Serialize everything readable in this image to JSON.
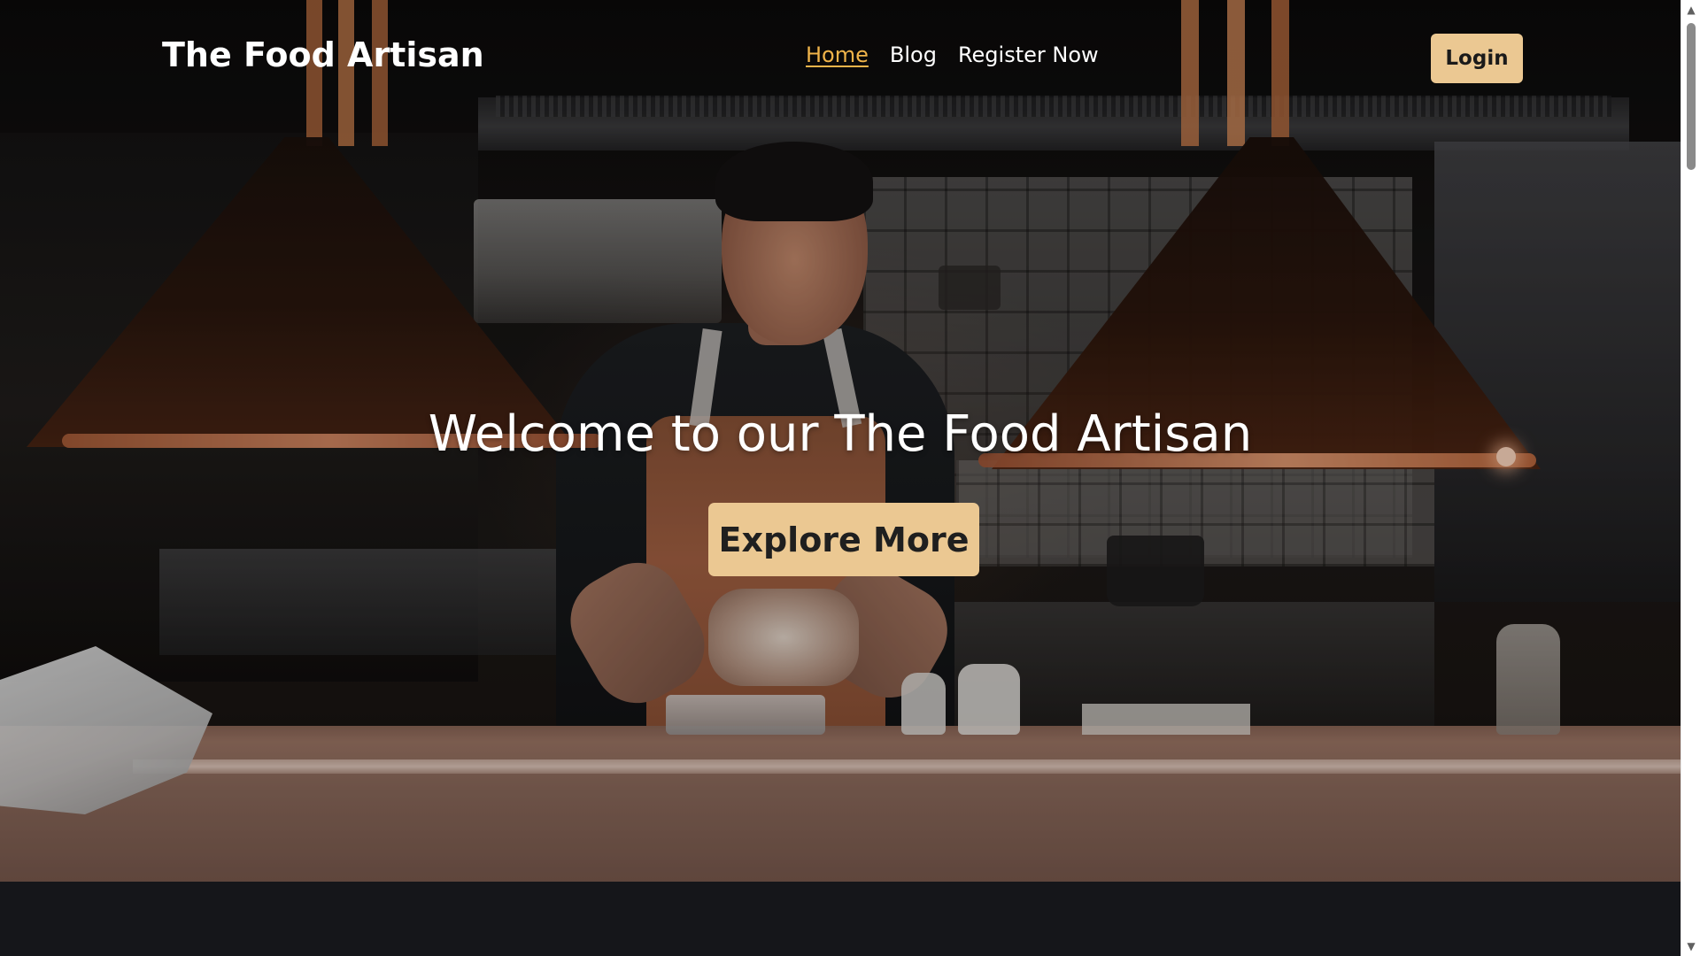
{
  "navbar": {
    "brand": "The Food Artisan",
    "links": [
      {
        "label": "Home",
        "active": true
      },
      {
        "label": "Blog",
        "active": false
      },
      {
        "label": "Register Now",
        "active": false
      }
    ],
    "login_label": "Login"
  },
  "hero": {
    "title": "Welcome to our The Food Artisan",
    "cta_label": "Explore More"
  },
  "colors": {
    "accent": "#ebc892",
    "active_link": "#f0b44a",
    "page_background": "#15161a"
  },
  "icons": {
    "scroll_up": "triangle-up-icon",
    "scroll_down": "triangle-down-icon"
  }
}
